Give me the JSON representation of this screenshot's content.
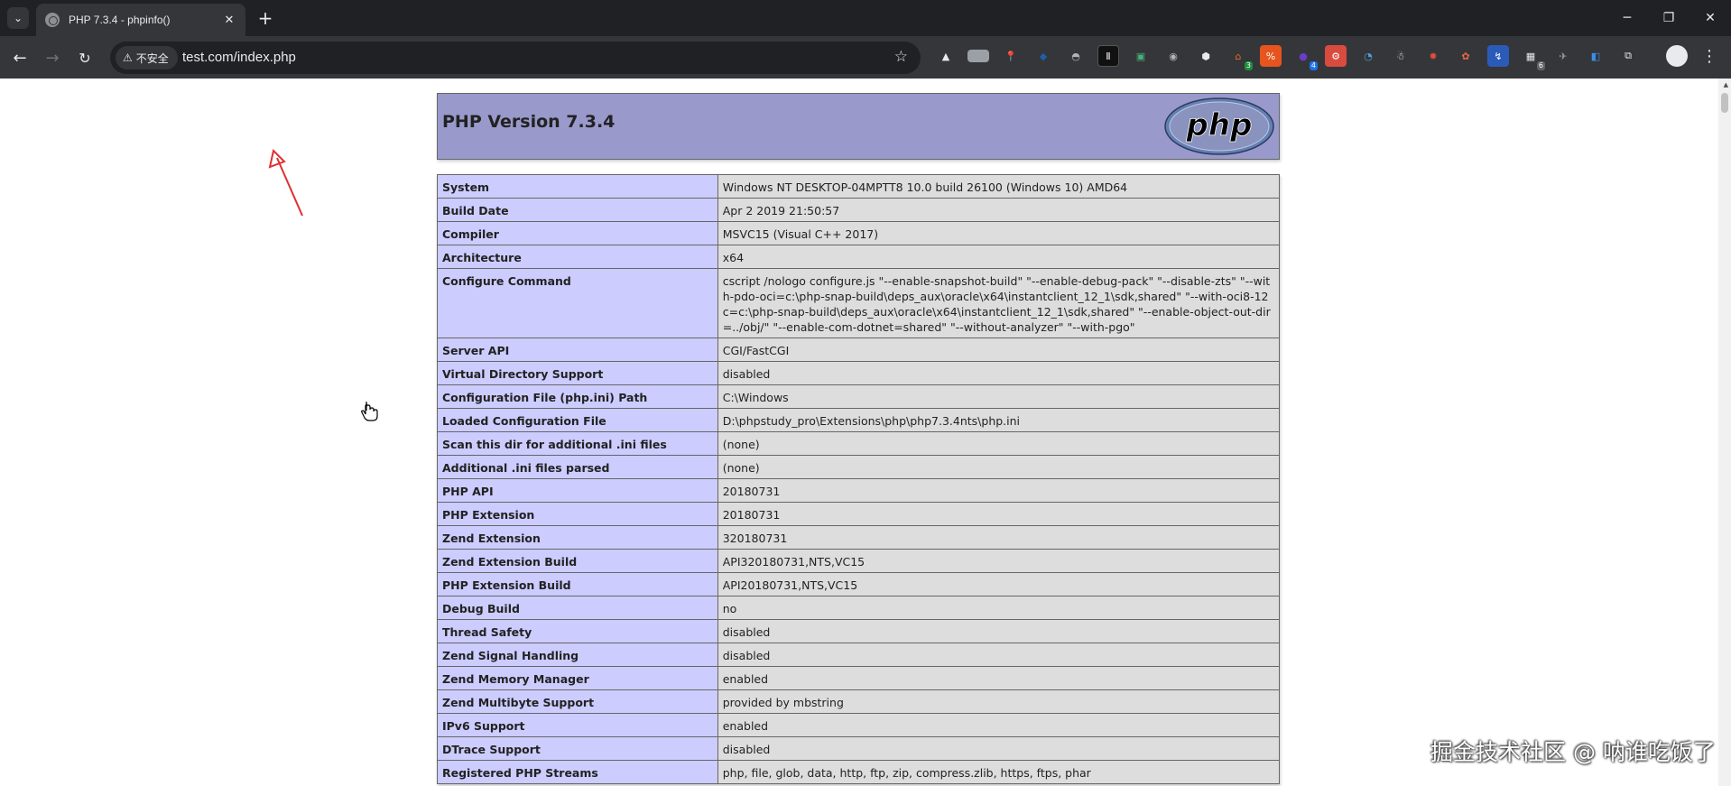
{
  "browser": {
    "tab_title": "PHP 7.3.4 - phpinfo()",
    "security_label": "不安全",
    "url": "test.com/index.php",
    "extension_badges": [
      "3",
      "4",
      "6"
    ]
  },
  "page": {
    "header_title": "PHP Version 7.3.4",
    "logo_text": "php",
    "rows": [
      {
        "key": "System",
        "value": "Windows NT DESKTOP-04MPTT8 10.0 build 26100 (Windows 10) AMD64"
      },
      {
        "key": "Build Date",
        "value": "Apr 2 2019 21:50:57"
      },
      {
        "key": "Compiler",
        "value": "MSVC15 (Visual C++ 2017)"
      },
      {
        "key": "Architecture",
        "value": "x64"
      },
      {
        "key": "Configure Command",
        "value": "cscript /nologo configure.js \"--enable-snapshot-build\" \"--enable-debug-pack\" \"--disable-zts\" \"--with-pdo-oci=c:\\php-snap-build\\deps_aux\\oracle\\x64\\instantclient_12_1\\sdk,shared\" \"--with-oci8-12c=c:\\php-snap-build\\deps_aux\\oracle\\x64\\instantclient_12_1\\sdk,shared\" \"--enable-object-out-dir=../obj/\" \"--enable-com-dotnet=shared\" \"--without-analyzer\" \"--with-pgo\""
      },
      {
        "key": "Server API",
        "value": "CGI/FastCGI"
      },
      {
        "key": "Virtual Directory Support",
        "value": "disabled"
      },
      {
        "key": "Configuration File (php.ini) Path",
        "value": "C:\\Windows"
      },
      {
        "key": "Loaded Configuration File",
        "value": "D:\\phpstudy_pro\\Extensions\\php\\php7.3.4nts\\php.ini"
      },
      {
        "key": "Scan this dir for additional .ini files",
        "value": "(none)"
      },
      {
        "key": "Additional .ini files parsed",
        "value": "(none)"
      },
      {
        "key": "PHP API",
        "value": "20180731"
      },
      {
        "key": "PHP Extension",
        "value": "20180731"
      },
      {
        "key": "Zend Extension",
        "value": "320180731"
      },
      {
        "key": "Zend Extension Build",
        "value": "API320180731,NTS,VC15"
      },
      {
        "key": "PHP Extension Build",
        "value": "API20180731,NTS,VC15"
      },
      {
        "key": "Debug Build",
        "value": "no"
      },
      {
        "key": "Thread Safety",
        "value": "disabled"
      },
      {
        "key": "Zend Signal Handling",
        "value": "disabled"
      },
      {
        "key": "Zend Memory Manager",
        "value": "enabled"
      },
      {
        "key": "Zend Multibyte Support",
        "value": "provided by mbstring"
      },
      {
        "key": "IPv6 Support",
        "value": "enabled"
      },
      {
        "key": "DTrace Support",
        "value": "disabled"
      },
      {
        "key": "Registered PHP Streams",
        "value": "php, file, glob, data, http, ftp, zip, compress.zlib, https, ftps, phar"
      }
    ]
  },
  "watermark": "掘金技术社区 @ 呐谁吃饭了",
  "colors": {
    "header_bg": "#9999cc",
    "key_bg": "#ccccff",
    "value_bg": "#dddddd",
    "chrome_dark": "#202124",
    "chrome_toolbar": "#35363a"
  }
}
